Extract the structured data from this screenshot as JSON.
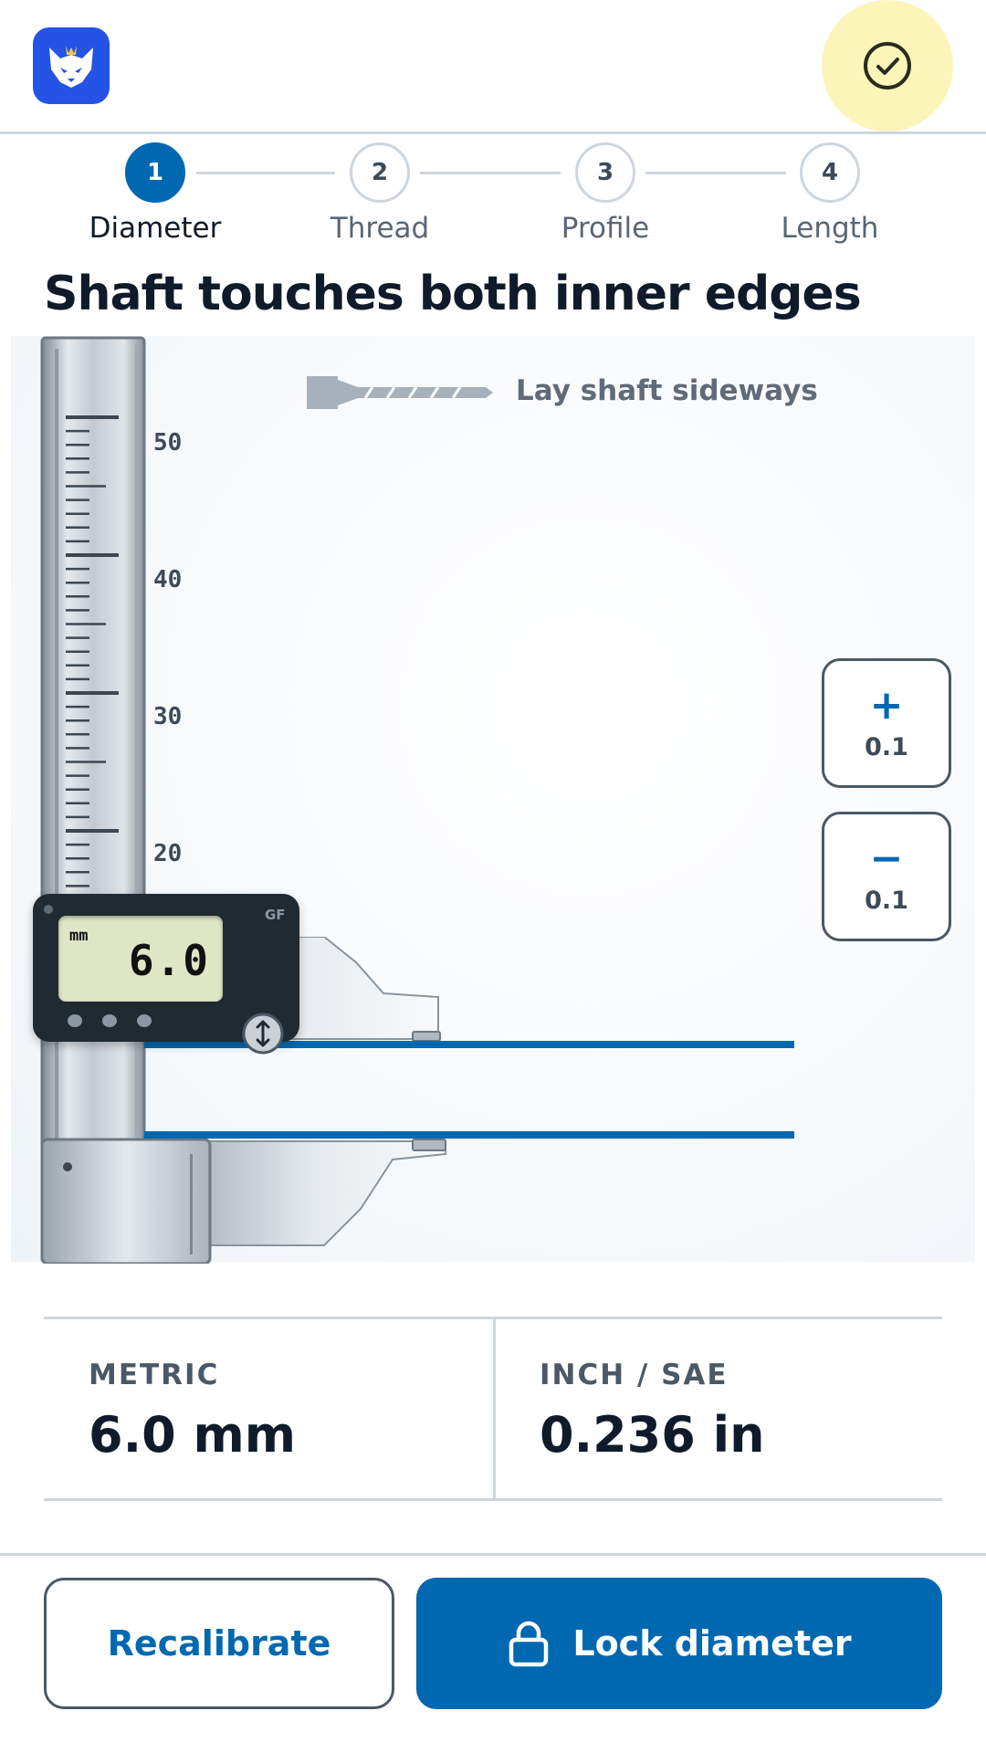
{
  "header": {
    "logo_icon": "fox-logo-icon",
    "help_icon": "check-circle-icon"
  },
  "stepper": {
    "active_step": 1,
    "steps": [
      {
        "number": "1",
        "label": "Diameter"
      },
      {
        "number": "2",
        "label": "Thread"
      },
      {
        "number": "3",
        "label": "Profile"
      },
      {
        "number": "4",
        "label": "Length"
      }
    ]
  },
  "instruction": "Shaft touches both inner edges",
  "gauge": {
    "hint": "Lay shaft sideways",
    "scale_labels": [
      "50",
      "40",
      "30",
      "20"
    ],
    "display": {
      "unit": "mm",
      "value": "6.0",
      "brand": "GF"
    },
    "increment": {
      "glyph": "+",
      "amount": "0.1"
    },
    "decrement": {
      "glyph": "−",
      "amount": "0.1"
    },
    "shaft_color": "#0068b0"
  },
  "readout": {
    "metric": {
      "label": "METRIC",
      "value": "6.0 mm"
    },
    "inch": {
      "label": "INCH / SAE",
      "value": "0.236 in"
    }
  },
  "actions": {
    "recalibrate": "Recalibrate",
    "lock": "Lock diameter",
    "lock_icon": "lock-icon"
  },
  "colors": {
    "accent": "#0068b0",
    "logo": "#2453e6",
    "help_bg": "#fbf5b9"
  }
}
